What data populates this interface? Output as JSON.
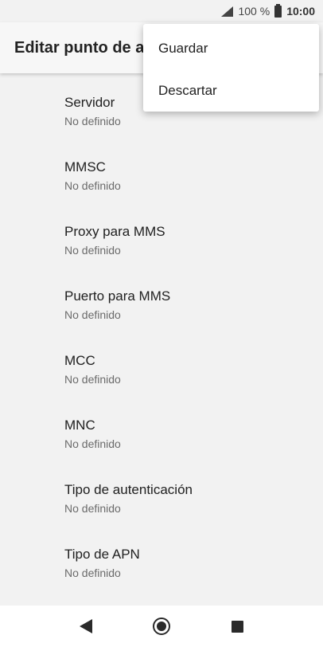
{
  "status_bar": {
    "battery_percent": "100 %",
    "time": "10:00",
    "icons": [
      "signal-icon",
      "battery-icon"
    ]
  },
  "app_bar": {
    "title": "Editar punto de a"
  },
  "overflow_menu": {
    "items": [
      {
        "label": "Guardar"
      },
      {
        "label": "Descartar"
      }
    ]
  },
  "settings": {
    "items": [
      {
        "label": "Servidor",
        "value": "No definido"
      },
      {
        "label": "MMSC",
        "value": "No definido"
      },
      {
        "label": "Proxy para MMS",
        "value": "No definido"
      },
      {
        "label": "Puerto para MMS",
        "value": "No definido"
      },
      {
        "label": "MCC",
        "value": "No definido"
      },
      {
        "label": "MNC",
        "value": "No definido"
      },
      {
        "label": "Tipo de autenticación",
        "value": "No definido"
      },
      {
        "label": "Tipo de APN",
        "value": "No definido"
      }
    ]
  },
  "nav_bar": {
    "icons": [
      "back-icon",
      "home-icon",
      "recent-apps-icon"
    ]
  }
}
